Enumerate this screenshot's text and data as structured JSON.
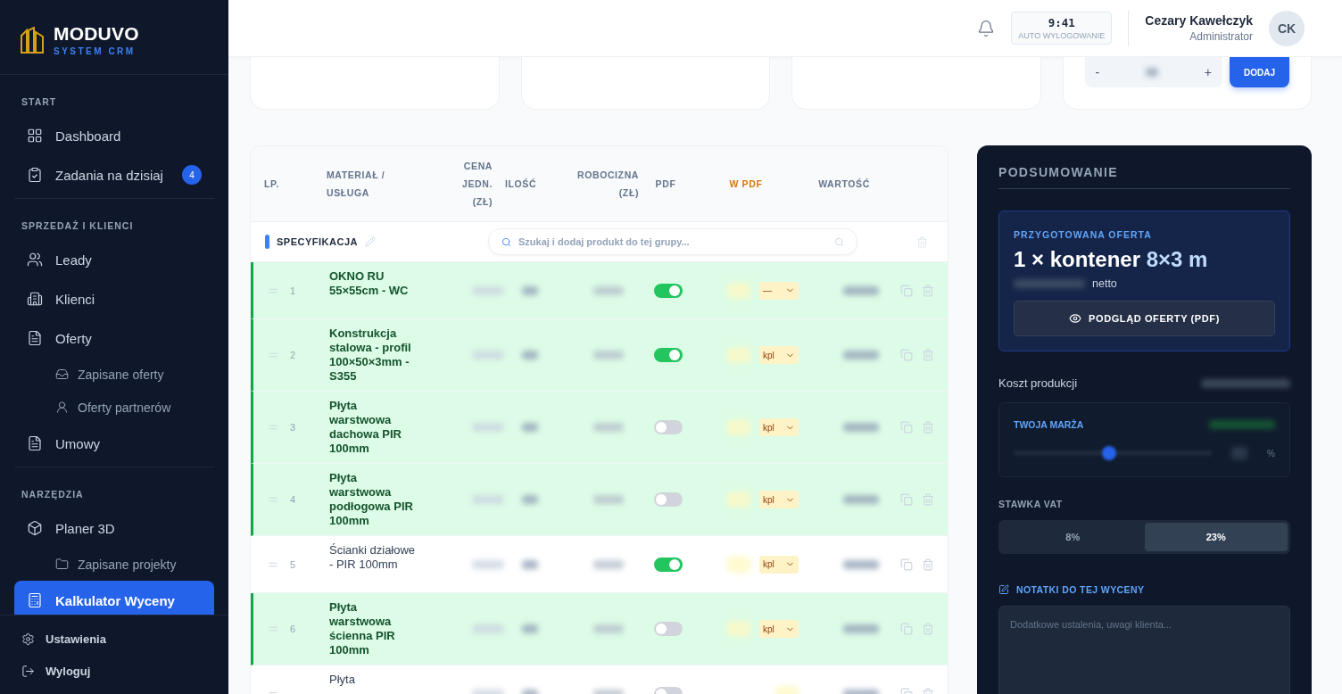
{
  "brand": {
    "name": "MODUVO",
    "tagline": "SYSTEM CRM"
  },
  "sidebar": {
    "sections": [
      {
        "title": "START",
        "items": [
          {
            "label": "Dashboard",
            "selected": false
          },
          {
            "label": "Zadania na dzisiaj",
            "badge": "4",
            "selected": false
          }
        ]
      },
      {
        "title": "SPRZEDAŻ I KLIENCI",
        "items": [
          {
            "label": "Leady",
            "selected": false
          },
          {
            "label": "Klienci",
            "selected": false
          },
          {
            "label": "Oferty",
            "selected": false,
            "children": [
              {
                "label": "Zapisane oferty",
                "selected": false
              },
              {
                "label": "Oferty partnerów",
                "selected": false
              }
            ]
          },
          {
            "label": "Umowy",
            "selected": false
          }
        ]
      },
      {
        "title": "NARZĘDZIA",
        "items": [
          {
            "label": "Planer 3D",
            "selected": false,
            "children": [
              {
                "label": "Zapisane projekty",
                "selected": false
              }
            ]
          },
          {
            "label": "Kalkulator Wyceny",
            "selected": true
          }
        ]
      }
    ],
    "footer": [
      {
        "label": "Ustawienia"
      },
      {
        "label": "Wyloguj"
      }
    ]
  },
  "header": {
    "timer": "9:41",
    "timer_label": "AUTO WYLOGOWANIE",
    "user_name": "Cezary Kawełczyk",
    "user_role": "Administrator",
    "initials": "CK"
  },
  "quantity_card": {
    "minus": "-",
    "plus": "+",
    "button": "DODAJ"
  },
  "table": {
    "columns": [
      "LP.",
      "MATERIAŁ / USŁUGA",
      "CENA JEDN. (ZŁ)",
      "ILOŚĆ",
      "ROBOCIZNA (ZŁ)",
      "PDF",
      "W PDF",
      "WARTOŚĆ"
    ],
    "group": {
      "name": "SPECYFIKACJA",
      "search_placeholder": "Szukaj i dodaj produkt do tej grupy..."
    },
    "rows": [
      {
        "lp": "1",
        "name": "OKNO RU 55×55cm - WC",
        "highlighted": true,
        "pdf": true,
        "unit": "—"
      },
      {
        "lp": "2",
        "name": "Konstrukcja stalowa - profil 100×50×3mm - S355",
        "highlighted": true,
        "pdf": true,
        "unit": "kpl"
      },
      {
        "lp": "3",
        "name": "Płyta warstwowa dachowa PIR 100mm",
        "highlighted": true,
        "pdf": false,
        "unit": "kpl"
      },
      {
        "lp": "4",
        "name": "Płyta warstwowa podłogowa PIR 100mm",
        "highlighted": true,
        "pdf": false,
        "unit": "kpl"
      },
      {
        "lp": "5",
        "name": "Ścianki działowe - PIR 100mm",
        "highlighted": false,
        "pdf": true,
        "unit": "kpl"
      },
      {
        "lp": "6",
        "name": "Płyta warstwowa ścienna PIR 100mm",
        "highlighted": true,
        "pdf": false,
        "unit": "kpl"
      },
      {
        "name": "Płyta",
        "highlighted": false,
        "pdf": false
      }
    ]
  },
  "summary": {
    "title": "PODSUMOWANIE",
    "offer_label": "PRZYGOTOWANA OFERTA",
    "offer_title": "1 × kontener",
    "offer_size": "8×3 m",
    "net_label": "netto",
    "preview_button": "PODGLĄD OFERTY (PDF)",
    "cost_label": "Koszt produkcji",
    "margin": {
      "label": "TWOJA MARŻA",
      "level": 0.48
    },
    "percent": "%",
    "vat_label": "STAWKA VAT",
    "vat_options": [
      {
        "label": "8%",
        "selected": false
      },
      {
        "label": "23%",
        "selected": true
      }
    ],
    "notes_label": "NOTATKI DO TEJ WYCENY",
    "notes_placeholder": "Dodatkowe ustalenia, uwagi klienta..."
  }
}
